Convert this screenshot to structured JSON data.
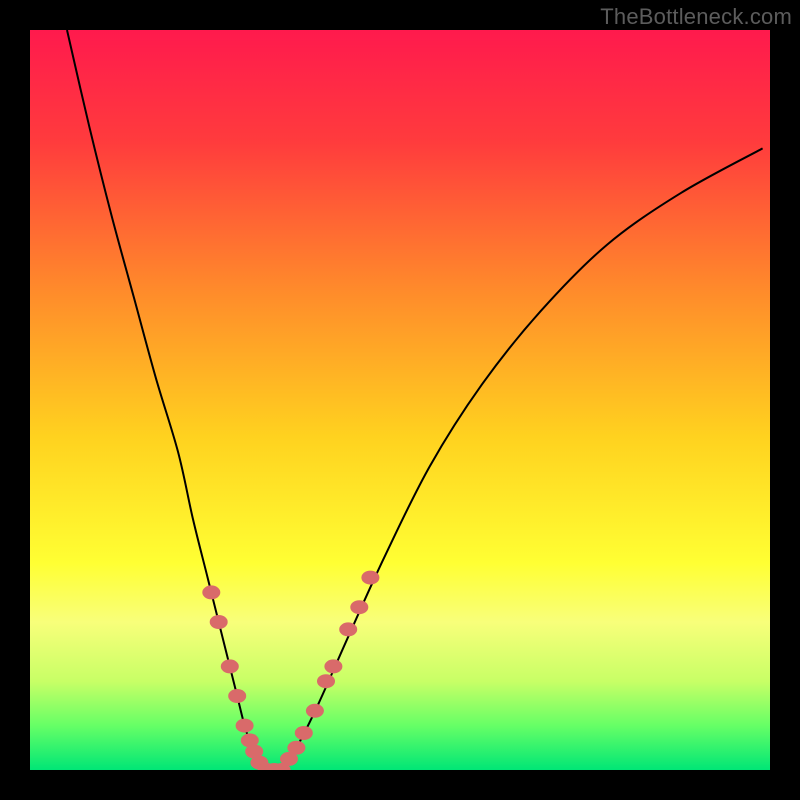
{
  "watermark": "TheBottleneck.com",
  "colors": {
    "gradient_stops": [
      {
        "pct": 0,
        "color": "#ff1a4d"
      },
      {
        "pct": 15,
        "color": "#ff3b3d"
      },
      {
        "pct": 35,
        "color": "#ff8a2b"
      },
      {
        "pct": 55,
        "color": "#ffd21f"
      },
      {
        "pct": 72,
        "color": "#ffff33"
      },
      {
        "pct": 80,
        "color": "#f8ff7a"
      },
      {
        "pct": 88,
        "color": "#c8ff66"
      },
      {
        "pct": 94,
        "color": "#66ff66"
      },
      {
        "pct": 100,
        "color": "#00e676"
      }
    ],
    "marker_fill": "#d96a6a",
    "curve_stroke": "#000000"
  },
  "chart_data": {
    "type": "line",
    "title": "",
    "xlabel": "",
    "ylabel": "",
    "xlim": [
      0,
      100
    ],
    "ylim": [
      0,
      100
    ],
    "series": [
      {
        "name": "left-curve",
        "x": [
          5,
          8,
          11,
          14,
          17,
          20,
          22,
          24,
          25.5,
          27,
          28,
          29,
          30,
          31,
          32
        ],
        "y": [
          100,
          87,
          75,
          64,
          53,
          43,
          34,
          26,
          20,
          14,
          10,
          6,
          3,
          1,
          0
        ]
      },
      {
        "name": "right-curve",
        "x": [
          34,
          36,
          39,
          43,
          48,
          54,
          61,
          69,
          78,
          88,
          99
        ],
        "y": [
          0,
          3,
          9,
          18,
          29,
          41,
          52,
          62,
          71,
          78,
          84
        ]
      }
    ],
    "flat_bottom": {
      "x_from": 32,
      "x_to": 34,
      "y": 0
    },
    "markers": [
      {
        "series": "left-curve",
        "x": 24.5,
        "y": 24
      },
      {
        "series": "left-curve",
        "x": 25.5,
        "y": 20
      },
      {
        "series": "left-curve",
        "x": 27.0,
        "y": 14
      },
      {
        "series": "left-curve",
        "x": 28.0,
        "y": 10
      },
      {
        "series": "left-curve",
        "x": 29.0,
        "y": 6
      },
      {
        "series": "left-curve",
        "x": 29.7,
        "y": 4
      },
      {
        "series": "left-curve",
        "x": 30.3,
        "y": 2.5
      },
      {
        "series": "left-curve",
        "x": 31.0,
        "y": 1
      },
      {
        "series": "flat",
        "x": 32.0,
        "y": 0
      },
      {
        "series": "flat",
        "x": 33.0,
        "y": 0
      },
      {
        "series": "flat",
        "x": 34.0,
        "y": 0
      },
      {
        "series": "right-curve",
        "x": 35.0,
        "y": 1.5
      },
      {
        "series": "right-curve",
        "x": 36.0,
        "y": 3
      },
      {
        "series": "right-curve",
        "x": 37.0,
        "y": 5
      },
      {
        "series": "right-curve",
        "x": 38.5,
        "y": 8
      },
      {
        "series": "right-curve",
        "x": 40.0,
        "y": 12
      },
      {
        "series": "right-curve",
        "x": 41.0,
        "y": 14
      },
      {
        "series": "right-curve",
        "x": 43.0,
        "y": 19
      },
      {
        "series": "right-curve",
        "x": 44.5,
        "y": 22
      },
      {
        "series": "right-curve",
        "x": 46.0,
        "y": 26
      }
    ]
  }
}
